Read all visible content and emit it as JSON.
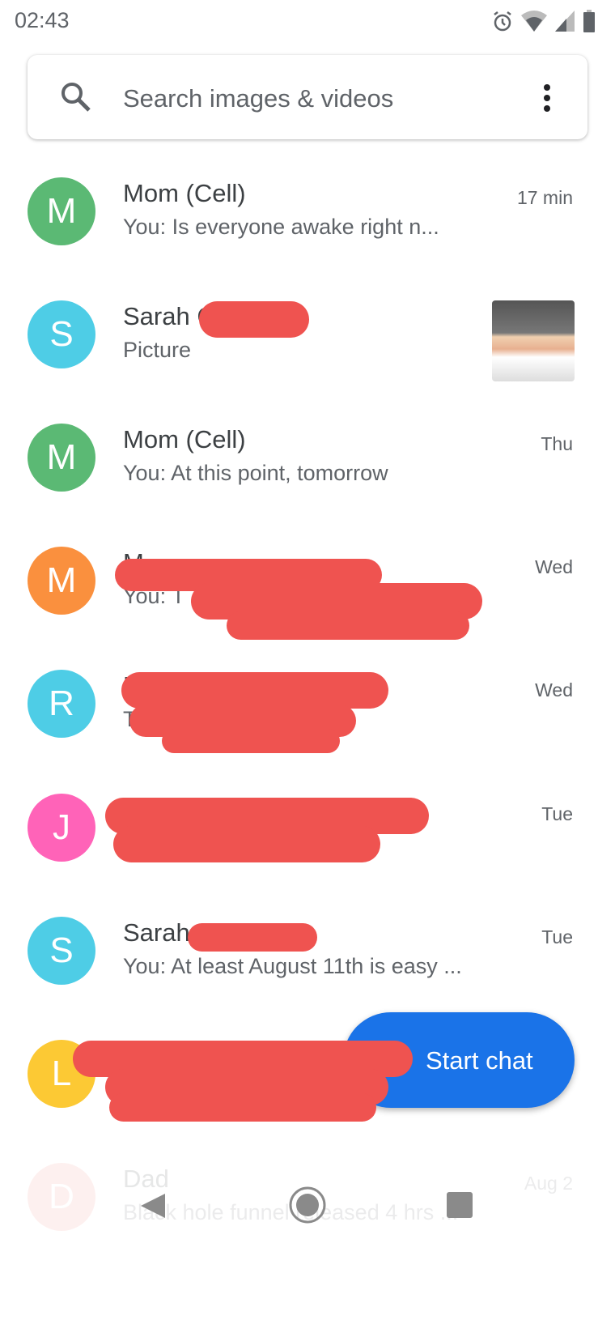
{
  "status_bar": {
    "time": "02:43",
    "icons": [
      "alarm-icon",
      "wifi-icon",
      "signal-icon",
      "battery-icon"
    ]
  },
  "search": {
    "placeholder": "Search images & videos"
  },
  "conversations": [
    {
      "initial": "M",
      "color": "#5bb974",
      "name": "Mom (Cell)",
      "snippet": "You: Is everyone awake right n...",
      "time": "17 min"
    },
    {
      "initial": "S",
      "color": "#4ecde6",
      "name": "Sarah C",
      "snippet": "Picture",
      "time": "",
      "has_thumbnail": true
    },
    {
      "initial": "M",
      "color": "#5bb974",
      "name": "Mom (Cell)",
      "snippet": "You: At this point, tomorrow",
      "time": "Thu"
    },
    {
      "initial": "M",
      "color": "#fa903e",
      "name": "M",
      "snippet": "You: T",
      "time": "Wed",
      "redacted": true
    },
    {
      "initial": "R",
      "color": "#4ecde6",
      "name": "R",
      "snippet": "T",
      "time": "Wed",
      "redacted": true
    },
    {
      "initial": "J",
      "color": "#ff63b8",
      "name": "",
      "snippet": "",
      "time": "Tue",
      "redacted": true
    },
    {
      "initial": "S",
      "color": "#4ecde6",
      "name": "Sarah",
      "snippet": "You: At least August 11th is easy ...",
      "time": "Tue",
      "redacted": true
    },
    {
      "initial": "L",
      "color": "#fcc934",
      "name": "",
      "snippet": "",
      "time": "",
      "redacted": true
    },
    {
      "initial": "D",
      "color": "#f28b82",
      "name": "Dad",
      "snippet": "Black hole funnel released 4 hrs ...",
      "time": "Aug 2"
    }
  ],
  "fab": {
    "label": "Start chat"
  },
  "nav": {
    "icons": [
      "back-icon",
      "home-icon",
      "recents-icon"
    ]
  }
}
